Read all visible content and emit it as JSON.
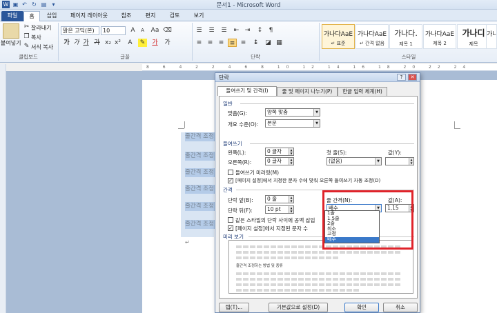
{
  "window": {
    "title": "문서1 - Microsoft Word"
  },
  "tabs": [
    "파일",
    "홈",
    "삽입",
    "페이지 레이아웃",
    "참조",
    "편지",
    "검토",
    "보기"
  ],
  "ribbon": {
    "clipboard": {
      "paste": "붙여넣기",
      "cut": "잘라내기",
      "copy": "복사",
      "format_painter": "서식 복사",
      "group": "클립보드"
    },
    "font": {
      "name": "맑은 고딕(본)",
      "size": "10",
      "group": "글꼴"
    },
    "paragraph": {
      "group": "단락"
    },
    "styles": {
      "group": "스타일",
      "items": [
        {
          "preview": "가나다AaE",
          "name": "↵ 표준"
        },
        {
          "preview": "가나다AaE",
          "name": "↵ 간격 없음"
        },
        {
          "preview": "가나다.",
          "name": "제목 1"
        },
        {
          "preview": "가나다AaE",
          "name": "제목 2"
        },
        {
          "preview": "가나디",
          "name": "제목"
        },
        {
          "preview": "가나다Aa",
          "name": ""
        }
      ]
    }
  },
  "ruler": {
    "text": "8 6 4 2 2 4 6 8 10 12 14 16 18 20 22 24"
  },
  "document": {
    "lines": [
      "줄간격 조정",
      "줄간격 조정",
      "줄간격 조정",
      "줄간격 조정",
      "줄간격 조정",
      "줄간격 조정"
    ]
  },
  "dialog": {
    "title": "단락",
    "tabs": [
      "들여쓰기 및 간격(I)",
      "줄 및 페이지 나누기(P)",
      "한글 입력 체계(H)"
    ],
    "general": {
      "heading": "일반",
      "align_label": "맞춤(G):",
      "align_value": "양쪽 맞춤",
      "outline_label": "개요 수준(O):",
      "outline_value": "본문"
    },
    "indent": {
      "heading": "들여쓰기",
      "left_label": "왼쪽(L):",
      "left_value": "0 글자",
      "right_label": "오른쪽(R):",
      "right_value": "0 글자",
      "first_label": "첫 줄(S):",
      "first_value": "(없음)",
      "by_label": "값(Y):",
      "by_value": "",
      "mirror": "들여쓰기 미러링(M)",
      "auto_adjust": "[페이지 설정]에서 지정한 문자 수에 맞춰 오른쪽 들여쓰기 자동 조정(D)"
    },
    "spacing": {
      "heading": "간격",
      "before_label": "단락 앞(B):",
      "before_value": "0 줄",
      "after_label": "단락 뒤(F):",
      "after_value": "10 pt",
      "line_label": "줄 간격(N):",
      "line_value": "배수",
      "at_label": "값(A):",
      "at_value": "1,15",
      "no_space": "같은 스타일의 단락 사이에 공백 삽입",
      "snap": "[페이지 설정]에서 지정된 문자 수"
    },
    "preview_label": "미리 보기",
    "preview_text": "줄간격 조정하는 방법 및 종류",
    "line_options": [
      "1줄",
      "1.5줄",
      "2줄",
      "최소",
      "고정",
      "배수"
    ],
    "line_selected_index": 5,
    "buttons": {
      "tabs": "탭(T)...",
      "default": "기본값으로 설정(D)",
      "ok": "확인",
      "cancel": "취소"
    }
  }
}
